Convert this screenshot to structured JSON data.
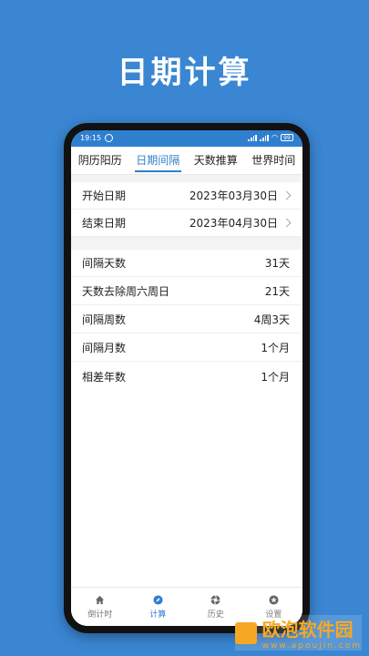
{
  "header": {
    "title": "日期计算"
  },
  "status_bar": {
    "time": "19:15",
    "battery": "99"
  },
  "tabs": [
    {
      "label": "阴历阳历",
      "active": false
    },
    {
      "label": "日期间隔",
      "active": true
    },
    {
      "label": "天数推算",
      "active": false
    },
    {
      "label": "世界时间",
      "active": false
    }
  ],
  "dates": {
    "start_label": "开始日期",
    "start_value": "2023年03月30日",
    "end_label": "结束日期",
    "end_value": "2023年04月30日"
  },
  "results": [
    {
      "label": "间隔天数",
      "value": "31天"
    },
    {
      "label": "天数去除周六周日",
      "value": "21天"
    },
    {
      "label": "间隔周数",
      "value": "4周3天"
    },
    {
      "label": "间隔月数",
      "value": "1个月"
    },
    {
      "label": "相差年数",
      "value": "1个月"
    }
  ],
  "nav": [
    {
      "label": "倒计时",
      "icon": "home-icon",
      "active": false
    },
    {
      "label": "计算",
      "icon": "compass-icon",
      "active": true
    },
    {
      "label": "历史",
      "icon": "aperture-icon",
      "active": false
    },
    {
      "label": "设置",
      "icon": "star-icon",
      "active": false
    }
  ],
  "watermark": {
    "text": "欧泡软件园",
    "sub": "www.apoujin.com"
  },
  "colors": {
    "background": "#3a86d3",
    "accent": "#2f7fcf",
    "watermark": "#f7a823"
  }
}
